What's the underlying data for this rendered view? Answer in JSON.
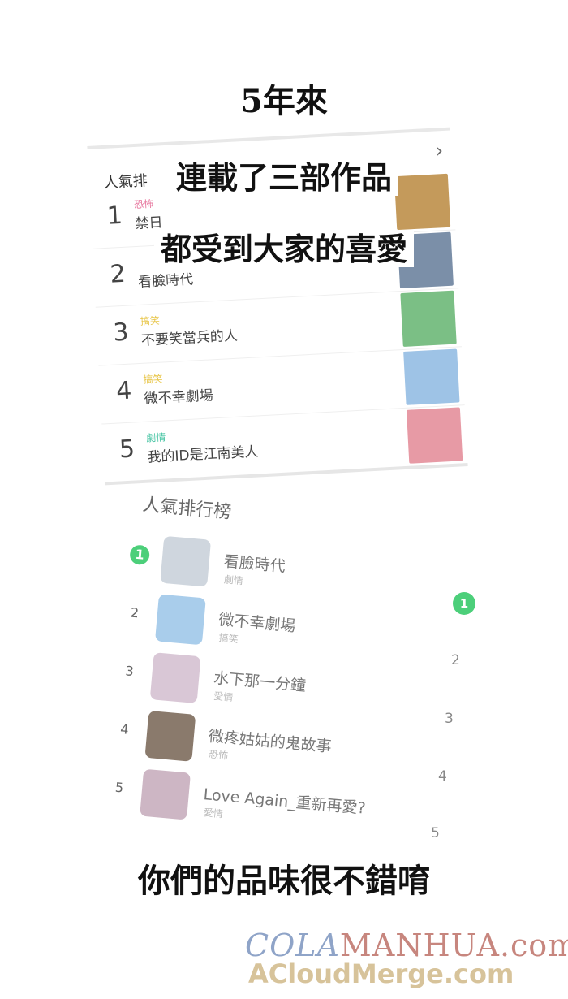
{
  "captions": {
    "top": "5年來",
    "line1": "連載了三部作品",
    "line2": "都受到大家的喜愛",
    "bottom": "你們的品味很不錯唷"
  },
  "card1": {
    "header": "人氣排",
    "items": [
      {
        "rank": "1",
        "genre": "恐怖",
        "genre_color": "#e6739b",
        "title": "禁日",
        "thumb": "#c49a5b"
      },
      {
        "rank": "2",
        "genre": "",
        "genre_color": "#999999",
        "title": "看臉時代",
        "thumb": "#7b8fa8"
      },
      {
        "rank": "3",
        "genre": "搞笑",
        "genre_color": "#e8c64a",
        "title": "不要笑當兵的人",
        "thumb": "#7bbf85"
      },
      {
        "rank": "4",
        "genre": "搞笑",
        "genre_color": "#e8c64a",
        "title": "微不幸劇場",
        "thumb": "#9ec3e6"
      },
      {
        "rank": "5",
        "genre": "劇情",
        "genre_color": "#48c5a4",
        "title": "我的ID是江南美人",
        "thumb": "#e79aa5"
      }
    ]
  },
  "card2": {
    "header": "人氣排行榜",
    "items": [
      {
        "rank": "1",
        "title": "看臉時代",
        "genre": "劇情",
        "thumb": "#cfd6de"
      },
      {
        "rank": "2",
        "title": "微不幸劇場",
        "genre": "搞笑",
        "thumb": "#a9cdeb"
      },
      {
        "rank": "3",
        "title": "水下那一分鐘",
        "genre": "愛情",
        "thumb": "#d9c7d6"
      },
      {
        "rank": "4",
        "title": "微疼姑姑的鬼故事",
        "genre": "恐怖",
        "thumb": "#8a7a6c"
      },
      {
        "rank": "5",
        "title": "Love Again_重新再愛?",
        "genre": "愛情",
        "thumb": "#cdb6c4"
      }
    ]
  },
  "side_ranks": [
    "1",
    "2",
    "3",
    "4",
    "5"
  ],
  "watermark": {
    "part1": "COLA",
    "part2": "MANHUA.com",
    "line2": "ACloudMerge.com"
  }
}
